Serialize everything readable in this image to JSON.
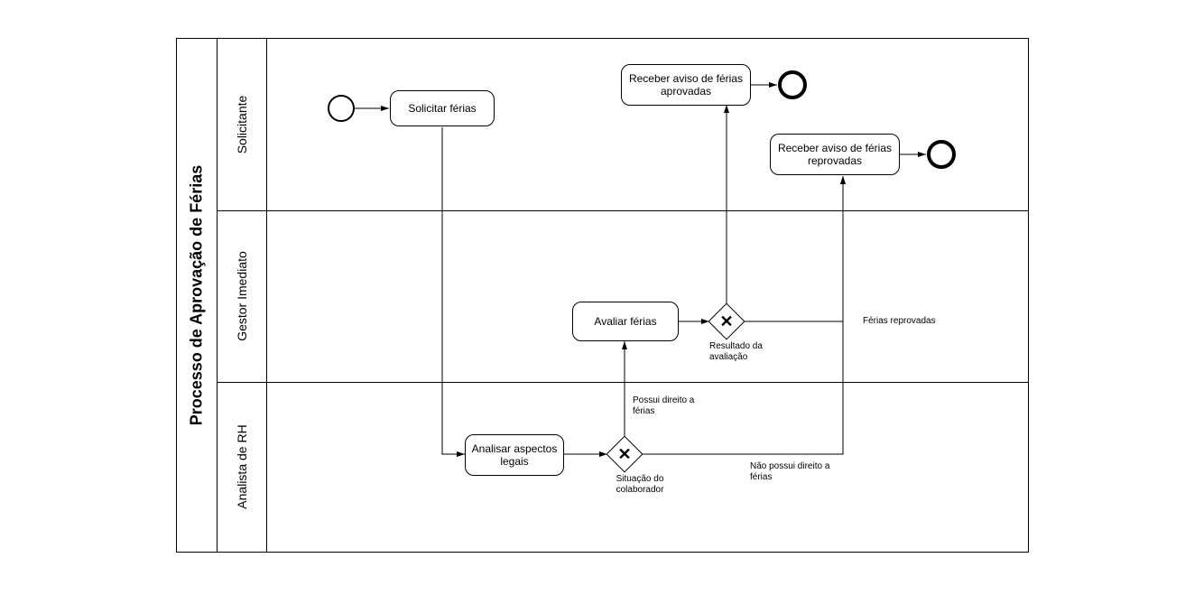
{
  "pool": {
    "title": "Processo de Aprovação de Férias"
  },
  "lanes": {
    "l1": "Solicitante",
    "l2": "Gestor Imediato",
    "l3": "Analista de RH"
  },
  "tasks": {
    "t1": "Solicitar férias",
    "t2": "Receber aviso de férias aprovadas",
    "t3": "Receber aviso de férias reprovadas",
    "t4": "Avaliar férias",
    "t5": "Analisar aspectos legais"
  },
  "gateways": {
    "g1_label": "Resultado da avaliação",
    "g2_label": "Situação do colaborador"
  },
  "edges": {
    "e_has_right": "Possui direito a férias",
    "e_no_right": "Não possui direito a férias",
    "e_rejected": "Férias reprovadas"
  }
}
